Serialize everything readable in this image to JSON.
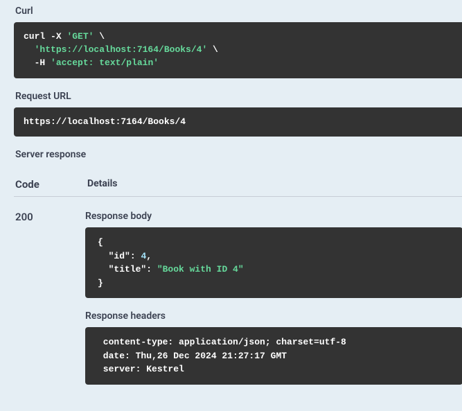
{
  "sections": {
    "curl_label": "Curl",
    "request_url_label": "Request URL",
    "server_response_label": "Server response",
    "code_header": "Code",
    "details_header": "Details",
    "response_body_label": "Response body",
    "response_headers_label": "Response headers"
  },
  "curl": {
    "cmd": "curl",
    "flag_x": "-X",
    "method": "'GET'",
    "cont1": " \\",
    "url": "'https://localhost:7164/Books/4'",
    "cont2": " \\",
    "flag_h": "-H",
    "accept": "'accept: text/plain'"
  },
  "request_url": "https://localhost:7164/Books/4",
  "response": {
    "code": "200",
    "body": {
      "open": "{",
      "indent": "  ",
      "k_id": "\"id\"",
      "colon1": ": ",
      "v_id": "4",
      "comma1": ",",
      "k_title": "\"title\"",
      "colon2": ": ",
      "v_title": "\"Book with ID 4\"",
      "close": "}"
    },
    "headers_text": " content-type: application/json; charset=utf-8 \n date: Thu,26 Dec 2024 21:27:17 GMT \n server: Kestrel "
  }
}
